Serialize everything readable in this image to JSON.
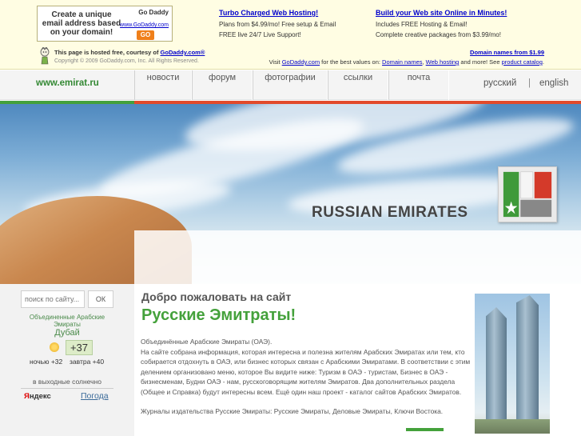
{
  "godaddy": {
    "ad_box": {
      "text": "Create a unique email address based on your domain!",
      "logo": "Go Daddy",
      "url": "www.GoDaddy.com",
      "go_label": "GO"
    },
    "col1": {
      "title": "Turbo Charged Web Hosting!",
      "line1": "Plans from $4.99/mo! Free setup & Email",
      "line2": "FREE live 24/7 Live Support!"
    },
    "col2": {
      "title": "Build your Web site Online in Minutes!",
      "line1": "Includes FREE Hosting & Email!",
      "line2": "Complete creative packages from $3.99/mo!"
    },
    "hosted_prefix": "This page is hosted free, courtesy of ",
    "hosted_link": "GoDaddy.com®",
    "copyright": "Copyright © 2009 GoDaddy.com, Inc. All Rights Reserved.",
    "domain_names_link": "Domain names from $1.99",
    "visit": {
      "prefix": "Visit ",
      "godaddy_link": "GoDaddy.com",
      "middle": " for the best values on: ",
      "domain_link": "Domain names",
      "comma": ", ",
      "hosting_link": "Web hosting",
      "more": " and more! See ",
      "catalog_link": "product catalog",
      "end": "."
    }
  },
  "nav": {
    "site_url": "www.emirat.ru",
    "items": [
      {
        "label": "новости"
      },
      {
        "label": "форум"
      },
      {
        "label": "фотографии"
      },
      {
        "label": "ссылки"
      },
      {
        "label": "почта"
      }
    ],
    "lang_ru": "русский",
    "lang_sep": "|",
    "lang_en": "english"
  },
  "hero": {
    "title": "RUSSIAN EMIRATES"
  },
  "sidebar": {
    "search_placeholder": "поиск по сайту...",
    "search_button": "ОК",
    "weather": {
      "country": "Объединенные Арабские Эмираты",
      "city": "Дубай",
      "temperature": "+37",
      "night": "ночью +32",
      "tomorrow": "завтра +40",
      "note": "в выходные солнечно",
      "provider": {
        "first": "Я",
        "rest": "ндекс"
      },
      "link": "Погода"
    }
  },
  "main": {
    "welcome": "Добро пожаловать на сайт",
    "site_name": "Русские Эмитраты!",
    "intro_line1": "Объединённые Арабские Эмираты (ОАЭ).",
    "intro_text": "На сайте собрана информация, которая интересна и полезна жителям Арабских Эмиратах или тем, кто собирается отдохнуть в ОАЭ, или бизнес которых связан с Арабскими Эмиратами. В соответствии с этим делением организовано меню, которое Вы видите ниже: Туризм в ОАЭ - туристам, Бизнес в ОАЭ - бизнесменам, Будни ОАЭ - нам, русскоговорящим жителям Эмиратов. Два дополнительных раздела (Общее и Справка) будут интересны всем. Ещё один наш проект - каталог сайтов Арабских Эмиратов.",
    "magazines": "Журналы издательства Русские Эмираты: Русские Эмираты, Деловые Эмираты, Ключи Востока."
  },
  "colors": {
    "accent_green": "#44a13b",
    "accent_red": "#e24a2b",
    "link_blue": "#0000cc"
  }
}
